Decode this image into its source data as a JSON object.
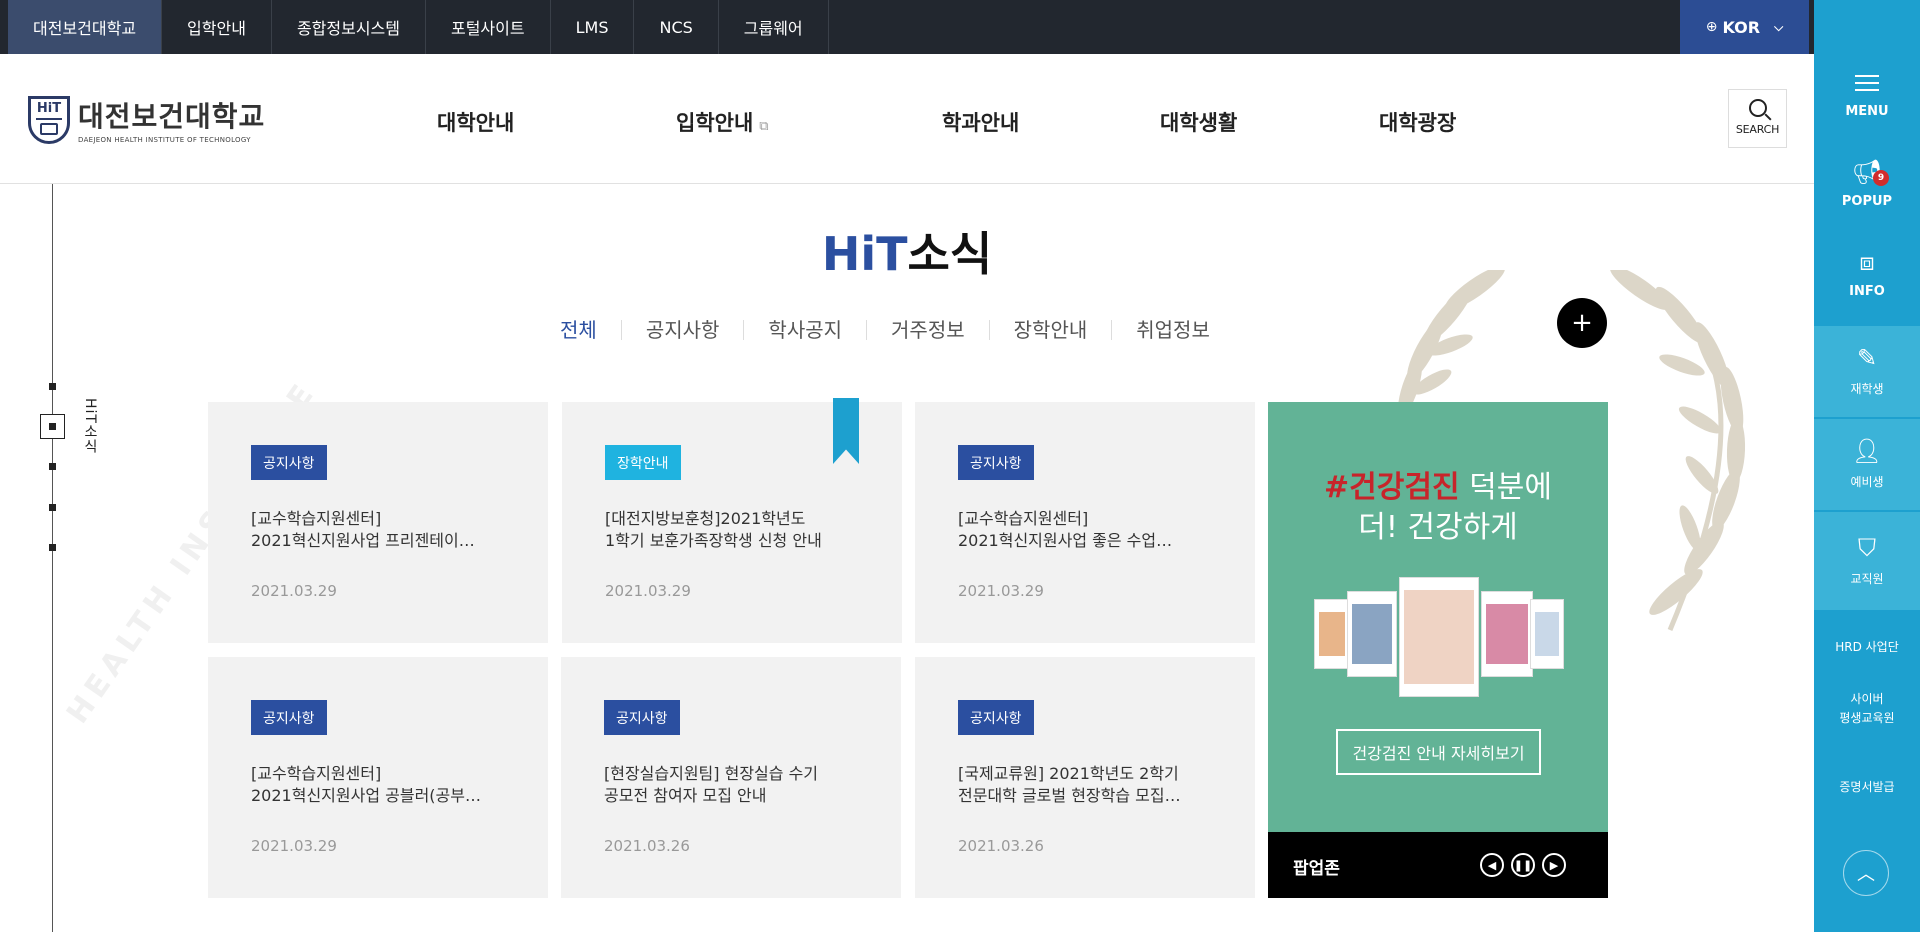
{
  "topbar": {
    "links": [
      "대전보건대학교",
      "입학안내",
      "종합정보시스템",
      "포털사이트",
      "LMS",
      "NCS",
      "그룹웨어"
    ],
    "lang": "KOR"
  },
  "header": {
    "logo_ko": "대전보건대학교",
    "logo_en": "DAEJEON HEALTH INSTITUTE OF TECHNOLOGY",
    "logo_mark": "HiT",
    "gnb": [
      "대학안내",
      "입학안내",
      "학과안내",
      "대학생활",
      "대학광장"
    ],
    "search_label": "SEARCH"
  },
  "quick": {
    "menu": "MENU",
    "popup": "POPUP",
    "popup_count": "9",
    "info": "INFO",
    "current_student": "재학생",
    "prospective": "예비생",
    "staff": "교직원",
    "hrd": "HRD 사업단",
    "cyber1": "사이버",
    "cyber2": "평생교육원",
    "certificate": "증명서발급"
  },
  "side": {
    "label": "HiT소식"
  },
  "section": {
    "title_en": "HiT",
    "title_ko": "소식",
    "tabs": [
      "전체",
      "공지사항",
      "학사공지",
      "거주정보",
      "장학안내",
      "취업정보"
    ]
  },
  "news": [
    {
      "category": "공지사항",
      "line1": "[교수학습지원센터]",
      "line2": "2021혁신지원사업 프리젠테이…",
      "date": "2021.03.29"
    },
    {
      "category": "장학안내",
      "line1": "[대전지방보훈청]2021학년도",
      "line2": "1학기 보훈가족장학생 신청 안내",
      "date": "2021.03.29"
    },
    {
      "category": "공지사항",
      "line1": "[교수학습지원센터]",
      "line2": "2021혁신지원사업 좋은 수업…",
      "date": "2021.03.29"
    },
    {
      "category": "공지사항",
      "line1": "[교수학습지원센터]",
      "line2": "2021혁신지원사업 공블러(공부…",
      "date": "2021.03.29"
    },
    {
      "category": "공지사항",
      "line1": "[현장실습지원팀] 현장실습 수기",
      "line2": "공모전 참여자 모집 안내",
      "date": "2021.03.26"
    },
    {
      "category": "공지사항",
      "line1": "[국제교류원] 2021학년도 2학기",
      "line2": "전문대학 글로벌 현장학습 모집…",
      "date": "2021.03.26"
    }
  ],
  "popupzone": {
    "headline_red": "#건강검진",
    "headline_rest": " 덕분에",
    "headline_line2": "더! 건강하게",
    "detail_button": "건강검진 안내 자세히보기",
    "name": "팝업존"
  },
  "colors": {
    "brand_blue": "#2b4fa0",
    "quick_bar": "#1da0cf",
    "popup_green": "#62b396",
    "topbar": "#22272f"
  }
}
